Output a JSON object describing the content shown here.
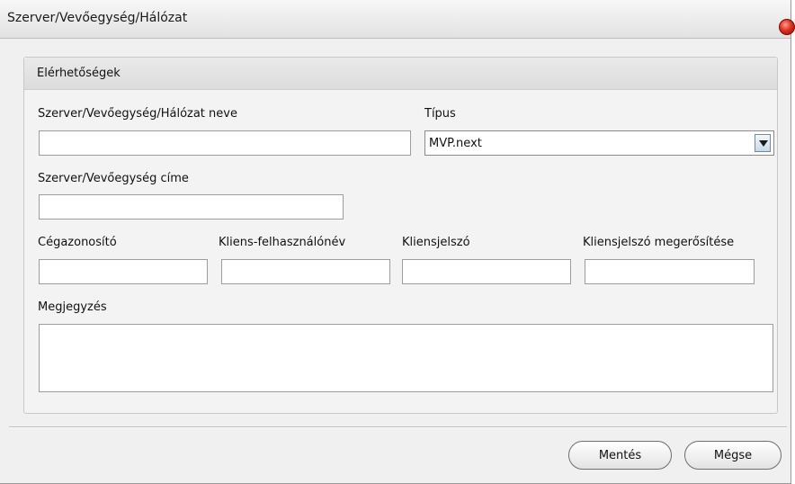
{
  "window": {
    "title": "Szerver/Vevőegység/Hálózat"
  },
  "group": {
    "title": "Elérhetőségek"
  },
  "fields": {
    "name": {
      "label": "Szerver/Vevőegység/Hálózat neve",
      "value": ""
    },
    "type": {
      "label": "Típus",
      "value": "MVP.next"
    },
    "address": {
      "label": "Szerver/Vevőegység címe",
      "value": ""
    },
    "company_id": {
      "label": "Cégazonosító",
      "value": ""
    },
    "client_username": {
      "label": "Kliens-felhasználónév",
      "value": ""
    },
    "client_password": {
      "label": "Kliensjelszó",
      "value": ""
    },
    "client_password_confirm": {
      "label": "Kliensjelszó megerősítése",
      "value": ""
    },
    "note": {
      "label": "Megjegyzés",
      "value": ""
    }
  },
  "buttons": {
    "save": "Mentés",
    "cancel": "Mégse"
  },
  "icons": {
    "close": "close-icon",
    "dropdown": "chevron-down-icon"
  }
}
